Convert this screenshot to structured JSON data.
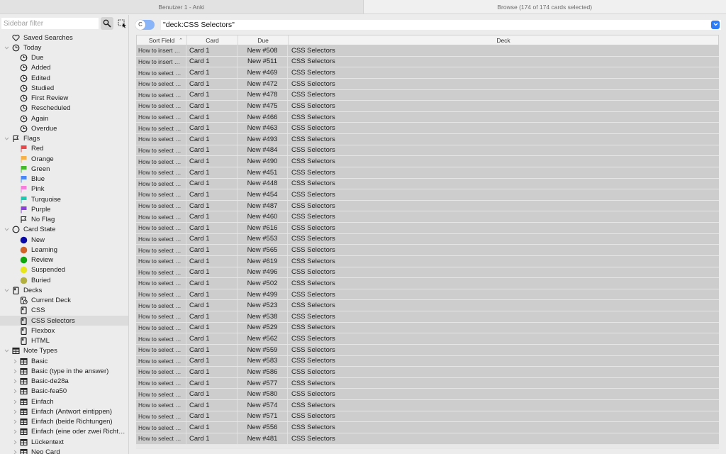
{
  "window": {
    "tabs": [
      {
        "label": "Benutzer 1 - Anki",
        "active": false
      },
      {
        "label": "Browse (174 of 174 cards selected)",
        "active": true
      }
    ]
  },
  "sidebar": {
    "filter_placeholder": "Sidebar filter",
    "search_icon": "magnifier-icon",
    "select_icon": "selection-cursor-icon",
    "items": [
      {
        "label": "Saved Searches",
        "icon": "heart-icon",
        "level": 0,
        "expandable": false
      },
      {
        "label": "Today",
        "icon": "clock-icon",
        "level": 0,
        "expandable": true,
        "expanded": true
      },
      {
        "label": "Due",
        "icon": "clock-icon",
        "level": 1
      },
      {
        "label": "Added",
        "icon": "clock-icon",
        "level": 1
      },
      {
        "label": "Edited",
        "icon": "clock-icon",
        "level": 1
      },
      {
        "label": "Studied",
        "icon": "clock-icon",
        "level": 1
      },
      {
        "label": "First Review",
        "icon": "clock-icon",
        "level": 1
      },
      {
        "label": "Rescheduled",
        "icon": "clock-icon",
        "level": 1
      },
      {
        "label": "Again",
        "icon": "clock-icon",
        "level": 1
      },
      {
        "label": "Overdue",
        "icon": "clock-icon",
        "level": 1
      },
      {
        "label": "Flags",
        "icon": "flag-outline-icon",
        "level": 0,
        "expandable": true,
        "expanded": true
      },
      {
        "label": "Red",
        "icon": "flag-icon",
        "color": "#e8474a",
        "level": 1
      },
      {
        "label": "Orange",
        "icon": "flag-icon",
        "color": "#f6b04a",
        "level": 1
      },
      {
        "label": "Green",
        "icon": "flag-icon",
        "color": "#46b82b",
        "level": 1
      },
      {
        "label": "Blue",
        "icon": "flag-icon",
        "color": "#4c88f5",
        "level": 1
      },
      {
        "label": "Pink",
        "icon": "flag-icon",
        "color": "#f57fdb",
        "level": 1
      },
      {
        "label": "Turquoise",
        "icon": "flag-icon",
        "color": "#1ec9b2",
        "level": 1
      },
      {
        "label": "Purple",
        "icon": "flag-icon",
        "color": "#8a3fd9",
        "level": 1
      },
      {
        "label": "No Flag",
        "icon": "flag-outline-icon",
        "level": 1
      },
      {
        "label": "Card State",
        "icon": "circle-outline-icon",
        "level": 0,
        "expandable": true,
        "expanded": true
      },
      {
        "label": "New",
        "icon": "dot-icon",
        "color": "#0a0aa8",
        "level": 1
      },
      {
        "label": "Learning",
        "icon": "dot-icon",
        "color": "#d0622a",
        "level": 1
      },
      {
        "label": "Review",
        "icon": "dot-icon",
        "color": "#0ea80e",
        "level": 1
      },
      {
        "label": "Suspended",
        "icon": "dot-icon",
        "color": "#e6e61a",
        "level": 1
      },
      {
        "label": "Buried",
        "icon": "dot-icon",
        "color": "#b3b03f",
        "level": 1
      },
      {
        "label": "Decks",
        "icon": "deck-icon",
        "level": 0,
        "expandable": true,
        "expanded": true
      },
      {
        "label": "Current Deck",
        "icon": "current-deck-icon",
        "level": 1
      },
      {
        "label": "CSS",
        "icon": "deck-icon",
        "level": 1
      },
      {
        "label": "CSS Selectors",
        "icon": "deck-icon",
        "level": 1,
        "selected": true
      },
      {
        "label": "Flexbox",
        "icon": "deck-icon",
        "level": 1
      },
      {
        "label": "HTML",
        "icon": "deck-icon",
        "level": 1
      },
      {
        "label": "Note Types",
        "icon": "notetype-icon",
        "level": 0,
        "expandable": true,
        "expanded": true
      },
      {
        "label": "Basic",
        "icon": "notetype-icon",
        "level": 1,
        "expandable": true
      },
      {
        "label": "Basic (type in the answer)",
        "icon": "notetype-icon",
        "level": 1,
        "expandable": true
      },
      {
        "label": "Basic-de28a",
        "icon": "notetype-icon",
        "level": 1,
        "expandable": true
      },
      {
        "label": "Basic-fea50",
        "icon": "notetype-icon",
        "level": 1,
        "expandable": true
      },
      {
        "label": "Einfach",
        "icon": "notetype-icon",
        "level": 1,
        "expandable": true
      },
      {
        "label": "Einfach (Antwort eintippen)",
        "icon": "notetype-icon",
        "level": 1,
        "expandable": true
      },
      {
        "label": "Einfach (beide Richtungen)",
        "icon": "notetype-icon",
        "level": 1,
        "expandable": true
      },
      {
        "label": "Einfach (eine oder zwei Richt…",
        "icon": "notetype-icon",
        "level": 1,
        "expandable": true
      },
      {
        "label": "Lückentext",
        "icon": "notetype-icon",
        "level": 1,
        "expandable": true
      },
      {
        "label": "Neo Card",
        "icon": "notetype-icon",
        "level": 1,
        "expandable": true
      }
    ]
  },
  "search": {
    "mode_toggle_label": "C",
    "query": "\"deck:CSS Selectors\"",
    "dropdown_icon": "chevron-down-icon"
  },
  "table": {
    "columns": [
      {
        "label": "Sort Field",
        "sorted": "ascending"
      },
      {
        "label": "Card"
      },
      {
        "label": "Due"
      },
      {
        "label": "Deck"
      }
    ],
    "rows": [
      [
        "How to insert …",
        "Card 1",
        "New #508",
        "CSS Selectors"
      ],
      [
        "How to insert …",
        "Card 1",
        "New #511",
        "CSS Selectors"
      ],
      [
        "How to select …",
        "Card 1",
        "New #469",
        "CSS Selectors"
      ],
      [
        "How to select …",
        "Card 1",
        "New #472",
        "CSS Selectors"
      ],
      [
        "How to select …",
        "Card 1",
        "New #478",
        "CSS Selectors"
      ],
      [
        "How to select …",
        "Card 1",
        "New #475",
        "CSS Selectors"
      ],
      [
        "How to select …",
        "Card 1",
        "New #466",
        "CSS Selectors"
      ],
      [
        "How to select …",
        "Card 1",
        "New #463",
        "CSS Selectors"
      ],
      [
        "How to select …",
        "Card 1",
        "New #493",
        "CSS Selectors"
      ],
      [
        "How to select …",
        "Card 1",
        "New #484",
        "CSS Selectors"
      ],
      [
        "How to select …",
        "Card 1",
        "New #490",
        "CSS Selectors"
      ],
      [
        "How to select …",
        "Card 1",
        "New #451",
        "CSS Selectors"
      ],
      [
        "How to select …",
        "Card 1",
        "New #448",
        "CSS Selectors"
      ],
      [
        "How to select …",
        "Card 1",
        "New #454",
        "CSS Selectors"
      ],
      [
        "How to select …",
        "Card 1",
        "New #487",
        "CSS Selectors"
      ],
      [
        "How to select …",
        "Card 1",
        "New #460",
        "CSS Selectors"
      ],
      [
        "How to select …",
        "Card 1",
        "New #616",
        "CSS Selectors"
      ],
      [
        "How to select …",
        "Card 1",
        "New #553",
        "CSS Selectors"
      ],
      [
        "How to select …",
        "Card 1",
        "New #565",
        "CSS Selectors"
      ],
      [
        "How to select …",
        "Card 1",
        "New #619",
        "CSS Selectors"
      ],
      [
        "How to select …",
        "Card 1",
        "New #496",
        "CSS Selectors"
      ],
      [
        "How to select …",
        "Card 1",
        "New #502",
        "CSS Selectors"
      ],
      [
        "How to select …",
        "Card 1",
        "New #499",
        "CSS Selectors"
      ],
      [
        "How to select …",
        "Card 1",
        "New #523",
        "CSS Selectors"
      ],
      [
        "How to select …",
        "Card 1",
        "New #538",
        "CSS Selectors"
      ],
      [
        "How to select …",
        "Card 1",
        "New #529",
        "CSS Selectors"
      ],
      [
        "How to select …",
        "Card 1",
        "New #562",
        "CSS Selectors"
      ],
      [
        "How to select …",
        "Card 1",
        "New #559",
        "CSS Selectors"
      ],
      [
        "How to select …",
        "Card 1",
        "New #583",
        "CSS Selectors"
      ],
      [
        "How to select …",
        "Card 1",
        "New #586",
        "CSS Selectors"
      ],
      [
        "How to select …",
        "Card 1",
        "New #577",
        "CSS Selectors"
      ],
      [
        "How to select …",
        "Card 1",
        "New #580",
        "CSS Selectors"
      ],
      [
        "How to select …",
        "Card 1",
        "New #574",
        "CSS Selectors"
      ],
      [
        "How to select …",
        "Card 1",
        "New #571",
        "CSS Selectors"
      ],
      [
        "How to select …",
        "Card 1",
        "New #556",
        "CSS Selectors"
      ],
      [
        "How to select …",
        "Card 1",
        "New #481",
        "CSS Selectors"
      ]
    ]
  }
}
